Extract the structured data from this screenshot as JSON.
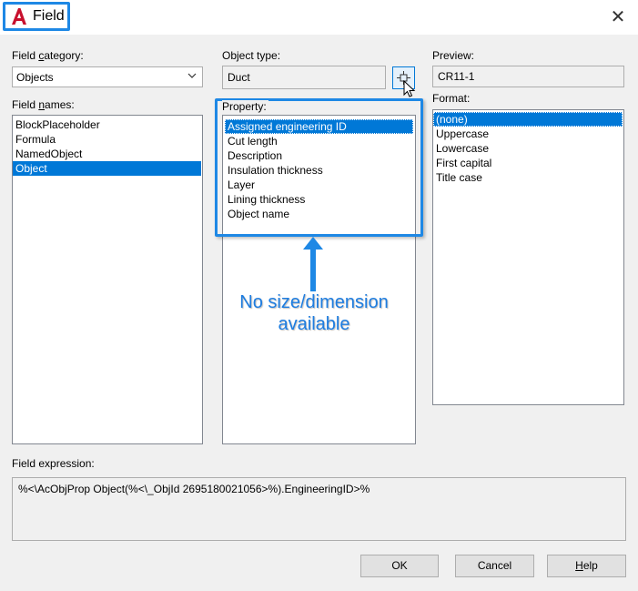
{
  "window": {
    "title": "Field",
    "close_glyph": "✕"
  },
  "field_category": {
    "label_pre": "Field ",
    "label_accel": "c",
    "label_post": "ategory:",
    "value": "Objects"
  },
  "field_names": {
    "label_pre": "Field ",
    "label_accel": "n",
    "label_post": "ames:",
    "items": [
      "BlockPlaceholder",
      "Formula",
      "NamedObject",
      "Object"
    ],
    "selected_index": 3
  },
  "object_type": {
    "label": "Object type:",
    "value": "Duct",
    "pick_icon": "select-object-icon"
  },
  "property": {
    "label": "Property:",
    "items": [
      "Assigned engineering ID",
      "Cut length",
      "Description",
      "Insulation thickness",
      "Layer",
      "Lining thickness",
      "Object name"
    ],
    "selected_index": 0
  },
  "preview": {
    "label": "Preview:",
    "value": "CR11-1"
  },
  "format": {
    "label": "Format:",
    "items": [
      "(none)",
      "Uppercase",
      "Lowercase",
      "First capital",
      "Title case"
    ],
    "selected_index": 0
  },
  "annotation": {
    "line1": "No size/dimension",
    "line2": "available",
    "color": "#1e7de0"
  },
  "field_expression": {
    "label": "Field expression:",
    "value": "%<\\AcObjProp Object(%<\\_ObjId 2695180021056>%).EngineeringID>%"
  },
  "buttons": {
    "ok": "OK",
    "cancel": "Cancel",
    "help_accel": "H",
    "help_post": "elp"
  },
  "colors": {
    "selection": "#0078d7",
    "highlight_border": "#1e88e5",
    "autocad_red": "#c8102e"
  }
}
